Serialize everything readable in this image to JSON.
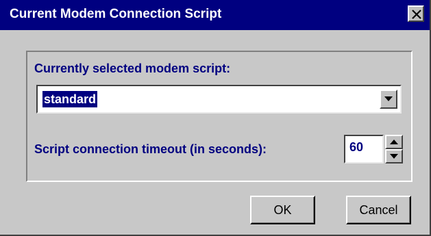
{
  "window": {
    "title": "Current Modem Connection Script"
  },
  "script_group": {
    "label": "Currently selected modem script:",
    "selected_value": "standard"
  },
  "timeout": {
    "label": "Script connection timeout (in seconds):",
    "value": "60"
  },
  "buttons": {
    "ok_label": "OK",
    "cancel_label": "Cancel"
  },
  "colors": {
    "titlebar": "#000080",
    "label_text": "#000080",
    "face": "#c0c0c0"
  },
  "icons": {
    "close": "close-icon",
    "dropdown": "chevron-down-icon",
    "spin_up": "chevron-up-icon",
    "spin_down": "chevron-down-icon"
  }
}
